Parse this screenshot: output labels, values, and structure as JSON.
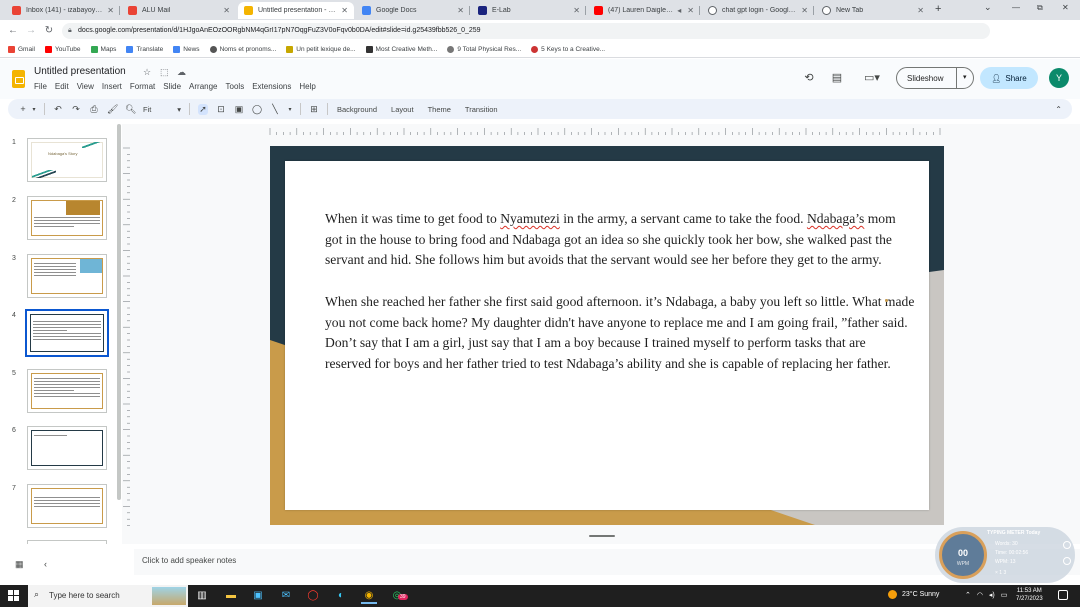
{
  "browser": {
    "tabs": [
      {
        "title": "Inbox (141) - izabayoyvan...",
        "color": "#ea4335"
      },
      {
        "title": "ALU Mail",
        "color": "#ea4335"
      },
      {
        "title": "Untitled presentation - G...",
        "color": "#f4b400"
      },
      {
        "title": "Google Docs",
        "color": "#4285f4"
      },
      {
        "title": "E-Lab",
        "color": "#1a237e"
      },
      {
        "title": "(47) Lauren Daigle - Yo",
        "color": "#ff0000"
      },
      {
        "title": "chat gpt login - Google Se...",
        "color": "#5f6368"
      },
      {
        "title": "New Tab",
        "color": "#5f6368"
      }
    ],
    "new_tab": "+",
    "window_controls": {
      "minimize": "—",
      "restore": "⧉",
      "close": "✕"
    },
    "url": "docs.google.com/presentation/d/1HJgoAnEOzOORgbNM4qGrI17pN7OqgFuZ3V0oFqv0b0DA/edit#slide=id.g25439fbb526_0_259",
    "bookmarks": [
      {
        "label": "Gmail",
        "color": "#ea4335"
      },
      {
        "label": "YouTube",
        "color": "#ff0000"
      },
      {
        "label": "Maps",
        "color": "#34a853"
      },
      {
        "label": "Translate",
        "color": "#4285f4"
      },
      {
        "label": "News",
        "color": "#4285f4"
      },
      {
        "label": "Noms et pronoms...",
        "color": "#555555"
      },
      {
        "label": "Un petit lexique de...",
        "color": "#c6a700"
      },
      {
        "label": "Most Creative Meth...",
        "color": "#333333"
      },
      {
        "label": "9 Total Physical Res...",
        "color": "#777777"
      },
      {
        "label": "5 Keys to a Creative...",
        "color": "#cc3333"
      }
    ]
  },
  "docs": {
    "title": "Untitled presentation",
    "menus": [
      "File",
      "Edit",
      "View",
      "Insert",
      "Format",
      "Slide",
      "Arrange",
      "Tools",
      "Extensions",
      "Help"
    ],
    "slideshow_label": "Slideshow",
    "share_label": "Share",
    "avatar_initial": "Y"
  },
  "toolbar": {
    "zoom": "Fit",
    "buttons": [
      "Background",
      "Layout",
      "Theme",
      "Transition"
    ]
  },
  "filmstrip": {
    "slides": [
      "1",
      "2",
      "3",
      "4",
      "5",
      "6",
      "7"
    ],
    "selected_index": 3,
    "thumb_1_title": "Ndabaga's Story"
  },
  "slide": {
    "paragraph_1_before": "When it was time to get food to ",
    "paragraph_1_name": "Nyamutezi",
    "paragraph_1_after_name": " in the army, a servant came to take the food. ",
    "paragraph_1_word2": "Ndabaga’s",
    "paragraph_1_rest": " mom got in the house to bring food and Ndabaga got an idea so she quickly took her bow, she walked past the servant and hid. She follows him but avoids that the servant would see her before they get to the army.",
    "paragraph_2": "When she reached her father she first said good afternoon. it’s Ndabaga, a baby you left so little. What made you not come back home? My daughter didn't have anyone to replace me and I am going frail, ”father said. Don’t say that I am a girl, just say that I am a boy because I trained myself to perform tasks that are reserved for boys and her father tried to test Ndabaga’s ability and she is capable of replacing her father.",
    "colors": {
      "dark_band": "#243a46",
      "tan": "#c99b4a",
      "grey": "#c9c6c2"
    }
  },
  "notes": {
    "placeholder": "Click to add speaker notes"
  },
  "meter": {
    "title": "TYPING METER Today",
    "gauge_value": "00",
    "gauge_unit": "WPM",
    "words_label": "Words:",
    "words_value": "30",
    "time_label": "Time:",
    "time_value": "00:02:56",
    "wpm_label": "WPM:",
    "wpm_value": "13",
    "footer": "× 1 3"
  },
  "taskbar": {
    "search_placeholder": "Type here to search",
    "weather": "23°C  Sunny",
    "time": "11:53 AM",
    "date": "7/27/2023",
    "whatsapp_badge": "39"
  }
}
